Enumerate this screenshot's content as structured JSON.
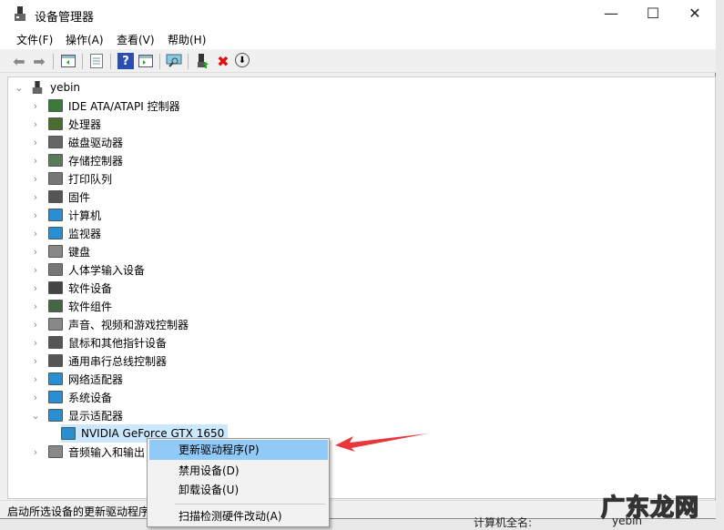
{
  "window": {
    "title": "设备管理器",
    "minimize": "—",
    "maximize": "☐",
    "close": "✕"
  },
  "menu": [
    "文件(F)",
    "操作(A)",
    "查看(V)",
    "帮助(H)"
  ],
  "toolbar": [
    "back",
    "forward",
    "console-tree",
    "properties",
    "help",
    "action-pane",
    "scan-hardware",
    "update-driver",
    "uninstall",
    "disable"
  ],
  "tree": {
    "root": "yebin",
    "categories": [
      {
        "label": "IDE ATA/ATAPI 控制器",
        "color": "#3a7a3a"
      },
      {
        "label": "处理器",
        "color": "#4b6e2e"
      },
      {
        "label": "磁盘驱动器",
        "color": "#666666"
      },
      {
        "label": "存储控制器",
        "color": "#5a7a5a"
      },
      {
        "label": "打印队列",
        "color": "#777777"
      },
      {
        "label": "固件",
        "color": "#555555"
      },
      {
        "label": "计算机",
        "color": "#2a8fd0"
      },
      {
        "label": "监视器",
        "color": "#2a8fd0"
      },
      {
        "label": "键盘",
        "color": "#888888"
      },
      {
        "label": "人体学输入设备",
        "color": "#777777"
      },
      {
        "label": "软件设备",
        "color": "#444444"
      },
      {
        "label": "软件组件",
        "color": "#446644"
      },
      {
        "label": "声音、视频和游戏控制器",
        "color": "#888888"
      },
      {
        "label": "鼠标和其他指针设备",
        "color": "#555555"
      },
      {
        "label": "通用串行总线控制器",
        "color": "#555555"
      },
      {
        "label": "网络适配器",
        "color": "#2a8fd0"
      },
      {
        "label": "系统设备",
        "color": "#2a8fd0"
      },
      {
        "label": "显示适配器",
        "color": "#2a8fd0",
        "expanded": true
      },
      {
        "label": "NVIDIA GeForce GTX 1650",
        "color": "#2a8fd0",
        "child": true,
        "selected": true
      },
      {
        "label": "音频输入和输出",
        "color": "#888888"
      }
    ]
  },
  "context_menu": {
    "items": [
      "更新驱动程序(P)",
      "禁用设备(D)",
      "卸载设备(U)",
      "扫描检测硬件改动(A)"
    ],
    "highlighted": 0
  },
  "status": "启动所选设备的更新驱动程序",
  "background": {
    "label": "计算机全名:",
    "value": "yebin"
  },
  "watermark": "广东龙网",
  "colors": {
    "highlight": "#91c9f7",
    "selection": "#cce8ff",
    "arrow": "#e8383d"
  }
}
